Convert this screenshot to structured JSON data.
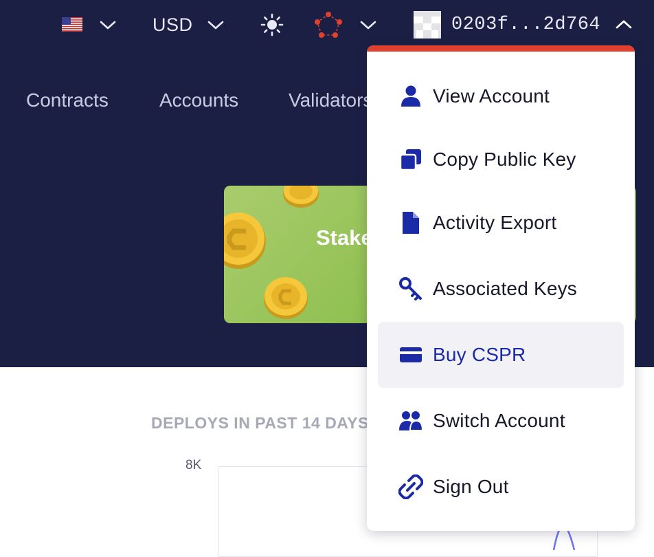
{
  "topbar": {
    "currency": "USD",
    "account_short": "0203f...2d764",
    "icons": [
      "us-flag-icon",
      "chevron-down-icon",
      "sun-icon",
      "network-icon",
      "account-avatar-icon",
      "chevron-up-icon"
    ]
  },
  "nav": {
    "items": [
      "Contracts",
      "Accounts",
      "Validators"
    ]
  },
  "banner": {
    "text": "Stake"
  },
  "chart": {
    "title": "DEPLOYS IN PAST 14 DAYS",
    "y_top_label": "8K"
  },
  "account_menu": {
    "items": [
      {
        "label": "View Account",
        "icon": "user-icon"
      },
      {
        "label": "Copy Public Key",
        "icon": "copy-icon"
      },
      {
        "label": "Activity Export",
        "icon": "file-icon"
      },
      {
        "label": "Associated Keys",
        "icon": "key-icon"
      },
      {
        "label": "Buy CSPR",
        "icon": "credit-card-icon",
        "active": true
      },
      {
        "label": "Switch Account",
        "icon": "users-icon"
      },
      {
        "label": "Sign Out",
        "icon": "unlink-icon"
      }
    ]
  },
  "colors": {
    "header_bg": "#1b1f44",
    "accent_red": "#e0412f",
    "icon_blue": "#1b2aa6",
    "banner_green": "#8dbf4e"
  }
}
